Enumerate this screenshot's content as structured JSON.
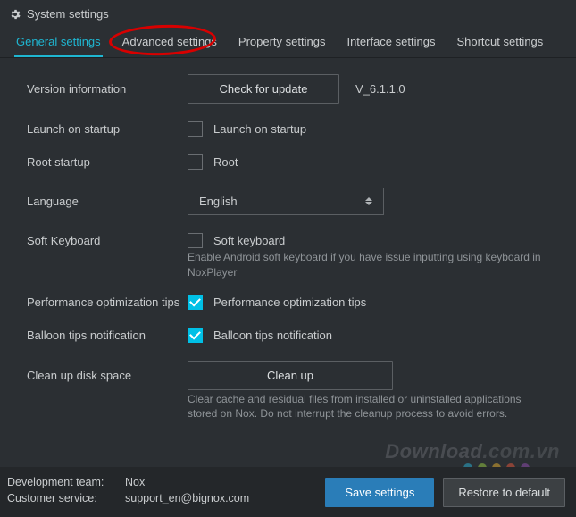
{
  "window": {
    "title": "System settings"
  },
  "tabs": {
    "general": "General settings",
    "advanced": "Advanced settings",
    "property": "Property settings",
    "interface": "Interface settings",
    "shortcut": "Shortcut settings"
  },
  "labels": {
    "version_info": "Version information",
    "launch_startup": "Launch on startup",
    "root_startup": "Root startup",
    "language": "Language",
    "soft_keyboard": "Soft Keyboard",
    "perf_tips": "Performance optimization tips",
    "balloon_tips": "Balloon tips notification",
    "clean_disk": "Clean up disk space"
  },
  "values": {
    "check_update_btn": "Check for update",
    "version": "V_6.1.1.0",
    "launch_startup_text": "Launch on startup",
    "root_text": "Root",
    "language_value": "English",
    "soft_keyboard_text": "Soft keyboard",
    "soft_keyboard_help": "Enable Android soft keyboard if you have issue inputting using keyboard in NoxPlayer",
    "perf_tips_text": "Performance optimization tips",
    "balloon_tips_text": "Balloon tips notification",
    "clean_up_btn": "Clean up",
    "clean_up_help": "Clear cache and residual files from installed or uninstalled applications stored on Nox. Do not interrupt the cleanup process to avoid errors."
  },
  "footer": {
    "dev_team_label": "Development team:",
    "dev_team_value": "Nox",
    "customer_label": "Customer service:",
    "customer_value": "support_en@bignox.com",
    "save": "Save settings",
    "restore": "Restore to default"
  },
  "watermark": {
    "text": "Download",
    "ext": ".com.vn"
  },
  "colors": {
    "accent": "#1fb6d1",
    "check": "#00c0e6",
    "primary_btn": "#2a7db8",
    "dots": [
      "#2aa8c9",
      "#8fbf3f",
      "#d9a62e",
      "#d9533a",
      "#8a4aa8"
    ]
  }
}
